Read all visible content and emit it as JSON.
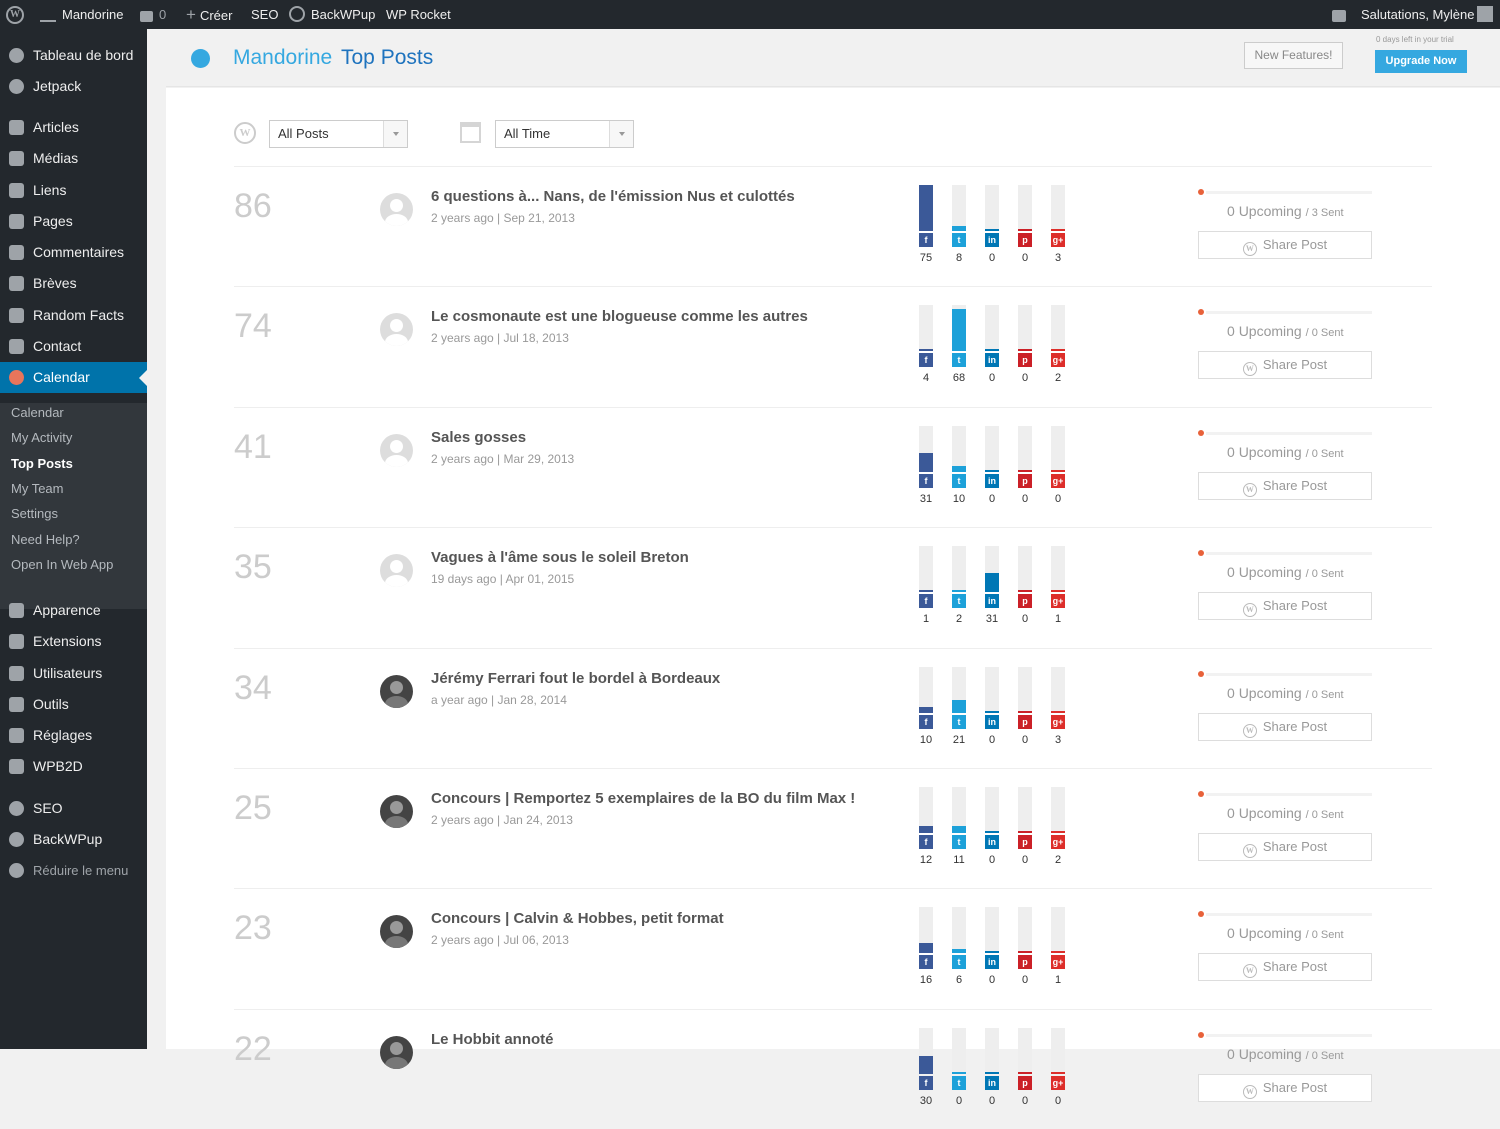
{
  "adminbar": {
    "site": "Mandorine",
    "comments": "0",
    "create": "Créer",
    "seo": "SEO",
    "backwpup": "BackWPup",
    "wprocket": "WP Rocket",
    "greeting": "Salutations, Mylène"
  },
  "sidebar": {
    "items": [
      {
        "label": "Tableau de bord",
        "icon": "dashboard-icon"
      },
      {
        "label": "Jetpack",
        "icon": "jetpack-icon"
      },
      {
        "label": "Articles",
        "icon": "pin-icon"
      },
      {
        "label": "Médias",
        "icon": "media-icon"
      },
      {
        "label": "Liens",
        "icon": "link-icon"
      },
      {
        "label": "Pages",
        "icon": "pages-icon"
      },
      {
        "label": "Commentaires",
        "icon": "comment-icon"
      },
      {
        "label": "Brèves",
        "icon": "pin-icon"
      },
      {
        "label": "Random Facts",
        "icon": "pin-icon"
      },
      {
        "label": "Contact",
        "icon": "mail-icon"
      },
      {
        "label": "Calendar",
        "icon": "calendar-icon"
      }
    ],
    "submenu": [
      "Calendar",
      "My Activity",
      "Top Posts",
      "My Team",
      "Settings",
      "Need Help?",
      "Open In Web App"
    ],
    "items2": [
      {
        "label": "Apparence",
        "icon": "brush-icon"
      },
      {
        "label": "Extensions",
        "icon": "plugin-icon"
      },
      {
        "label": "Utilisateurs",
        "icon": "users-icon"
      },
      {
        "label": "Outils",
        "icon": "tools-icon"
      },
      {
        "label": "Réglages",
        "icon": "settings-icon"
      },
      {
        "label": "WPB2D",
        "icon": "wpb2d-icon"
      },
      {
        "label": "SEO",
        "icon": "seo-icon"
      },
      {
        "label": "BackWPup",
        "icon": "backwpup-icon"
      },
      {
        "label": "Réduire le menu",
        "icon": "collapse-icon"
      }
    ]
  },
  "header": {
    "brand": "Mandorine",
    "title": "Top Posts",
    "new_features": "New Features!",
    "trial": "0 days left in your trial",
    "upgrade": "Upgrade Now"
  },
  "filters": {
    "post_type": "All Posts",
    "period": "All Time"
  },
  "colors": {
    "facebook": "#3b5998",
    "twitter": "#1da1d9",
    "linkedin": "#0077b5",
    "pinterest": "#cb2027",
    "googleplus": "#dd2e2a",
    "accent": "#35a8e0"
  },
  "share_label": "Share Post",
  "upcoming_label": "Upcoming",
  "posts": [
    {
      "rank": "86",
      "title": "6 questions à... Nans, de l'émission Nus et culottés",
      "meta": "2 years ago | Sep 21, 2013",
      "avatar": "default",
      "counts": [
        75,
        8,
        0,
        0,
        3
      ],
      "upcoming": "0",
      "sent": "/ 3 Sent"
    },
    {
      "rank": "74",
      "title": "Le cosmonaute est une blogueuse comme les autres",
      "meta": "2 years ago | Jul 18, 2013",
      "avatar": "default",
      "counts": [
        4,
        68,
        0,
        0,
        2
      ],
      "upcoming": "0",
      "sent": "/ 0 Sent"
    },
    {
      "rank": "41",
      "title": "Sales gosses",
      "meta": "2 years ago | Mar 29, 2013",
      "avatar": "default",
      "counts": [
        31,
        10,
        0,
        0,
        0
      ],
      "upcoming": "0",
      "sent": "/ 0 Sent"
    },
    {
      "rank": "35",
      "title": "Vagues à l'âme sous le soleil Breton",
      "meta": "19 days ago | Apr 01, 2015",
      "avatar": "default",
      "counts": [
        1,
        2,
        31,
        0,
        1
      ],
      "upcoming": "0",
      "sent": "/ 0 Sent"
    },
    {
      "rank": "34",
      "title": "Jérémy Ferrari fout le bordel à Bordeaux",
      "meta": "a year ago | Jan 28, 2014",
      "avatar": "photo",
      "counts": [
        10,
        21,
        0,
        0,
        3
      ],
      "upcoming": "0",
      "sent": "/ 0 Sent"
    },
    {
      "rank": "25",
      "title": "Concours | Remportez 5 exemplaires de la BO du film Max !",
      "meta": "2 years ago | Jan 24, 2013",
      "avatar": "photo",
      "counts": [
        12,
        11,
        0,
        0,
        2
      ],
      "upcoming": "0",
      "sent": "/ 0 Sent"
    },
    {
      "rank": "23",
      "title": "Concours | Calvin & Hobbes, petit format",
      "meta": "2 years ago | Jul 06, 2013",
      "avatar": "photo",
      "counts": [
        16,
        6,
        0,
        0,
        1
      ],
      "upcoming": "0",
      "sent": "/ 0 Sent"
    },
    {
      "rank": "22",
      "title": "Le Hobbit annoté",
      "meta": "",
      "avatar": "photo",
      "counts": [
        30,
        0,
        0,
        0,
        0
      ],
      "upcoming": "0",
      "sent": "/ 0 Sent"
    }
  ]
}
